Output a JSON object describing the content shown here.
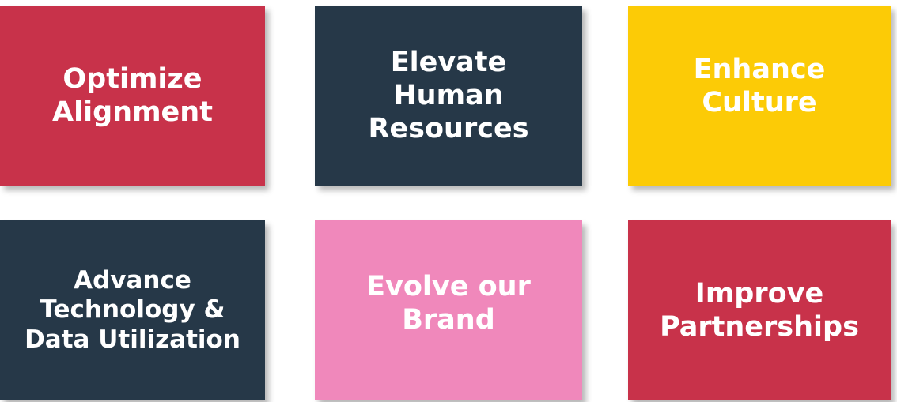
{
  "tiles": [
    {
      "label": "Optimize\nAlignment",
      "color": "#c8324a"
    },
    {
      "label": "Elevate\nHuman\nResources",
      "color": "#263848"
    },
    {
      "label": "Enhance\nCulture",
      "color": "#fccb06"
    },
    {
      "label": "Advance\nTechnology &\nData Utilization",
      "color": "#263848"
    },
    {
      "label": "Evolve our\nBrand",
      "color": "#f088bb"
    },
    {
      "label": "Improve\nPartnerships",
      "color": "#c8324a"
    }
  ]
}
